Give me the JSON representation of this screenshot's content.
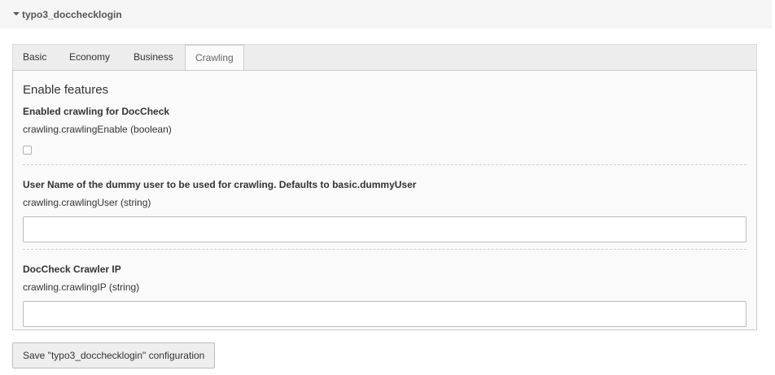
{
  "extension": {
    "title": "typo3_docchecklogin",
    "caret_icon": "caret-down-icon"
  },
  "tabs": [
    {
      "label": "Basic",
      "active": false
    },
    {
      "label": "Economy",
      "active": false
    },
    {
      "label": "Business",
      "active": false
    },
    {
      "label": "Crawling",
      "active": true
    }
  ],
  "section": {
    "title": "Enable features"
  },
  "fields": [
    {
      "label": "Enabled crawling for DocCheck",
      "key": "crawling.crawlingEnable (boolean)",
      "type": "checkbox",
      "checked": false
    },
    {
      "label": "User Name of the dummy user to be used for crawling. Defaults to basic.dummyUser",
      "key": "crawling.crawlingUser (string)",
      "type": "text",
      "value": ""
    },
    {
      "label": "DocCheck Crawler IP",
      "key": "crawling.crawlingIP (string)",
      "type": "text",
      "value": ""
    }
  ],
  "save_button": {
    "label": "Save \"typo3_docchecklogin\" configuration"
  }
}
